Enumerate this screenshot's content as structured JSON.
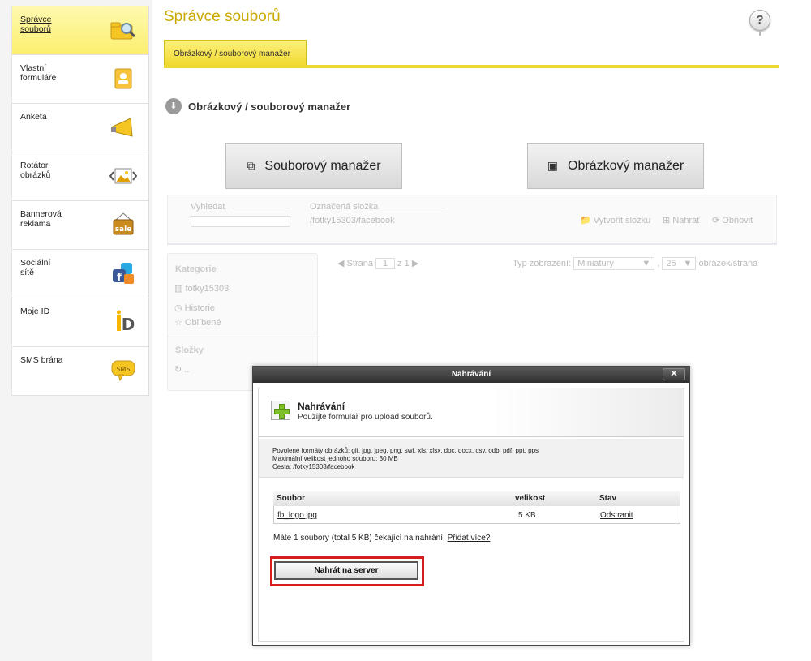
{
  "sidebar": {
    "items": [
      {
        "label": "Správce\nsouborů",
        "icon": "folder-search-icon",
        "active": true
      },
      {
        "label": "Vlastní\nformuláře",
        "icon": "contact-book-icon"
      },
      {
        "label": "Anketa",
        "icon": "megaphone-icon"
      },
      {
        "label": "Rotátor\nobrázků",
        "icon": "image-rotator-icon"
      },
      {
        "label": "Bannerová\nreklama",
        "icon": "sale-sign-icon"
      },
      {
        "label": "Sociální\nsítě",
        "icon": "social-icon"
      },
      {
        "label": "Moje ID",
        "icon": "mojeid-icon"
      },
      {
        "label": "SMS brána",
        "icon": "sms-bubble-icon"
      }
    ]
  },
  "header": {
    "title": "Správce souborů",
    "help": "?",
    "tab_label": "Obrázkový / souborový manažer"
  },
  "section": {
    "title": "Obrázkový / souborový manažer",
    "file_manager_button": "Souborový manažer",
    "image_manager_button": "Obrázkový manažer"
  },
  "background_manager": {
    "search_label": "Vyhledat",
    "folder_label": "Označená složka",
    "folder_path": "/fotky15303/facebook",
    "create_folder": "Vytvořit složku",
    "upload": "Nahrát",
    "refresh": "Obnovit",
    "pager_page": "Strana",
    "pager_value": "1",
    "pager_of": "z 1",
    "view_label": "Typ zobrazení:",
    "view_value": "Miniatury",
    "per_page_value": "25",
    "per_page_label": "obrázek/strana",
    "categories_title": "Kategorie",
    "cat_folder": "fotky15303",
    "cat_history": "Historie",
    "cat_favorites": "Oblíbené",
    "folders_title": "Složky",
    "folder_item": ".."
  },
  "dialog": {
    "title": "Nahrávání",
    "close": "✕",
    "heading": "Nahrávání",
    "subheading": "Použijte formulář pro upload souborů.",
    "info_formats": "Povolené formáty obrázků: gif, jpg, jpeg, png, swf, xls, xlsx, doc, docx, csv, odb, pdf, ppt, pps",
    "info_max": "Maximální velikost jednoho souboru: 30 MB",
    "info_path": "Cesta: /fotky15303/facebook",
    "columns": [
      "Soubor",
      "velikost",
      "Stav"
    ],
    "files": [
      {
        "name": "fb_logo.jpg",
        "size": "5 KB",
        "action": "Odstranit"
      }
    ],
    "status_text": "Máte 1 soubory (total 5 KB) čekající na nahrání.",
    "add_more": "Přidat více?",
    "upload_button": "Nahrát na server"
  }
}
